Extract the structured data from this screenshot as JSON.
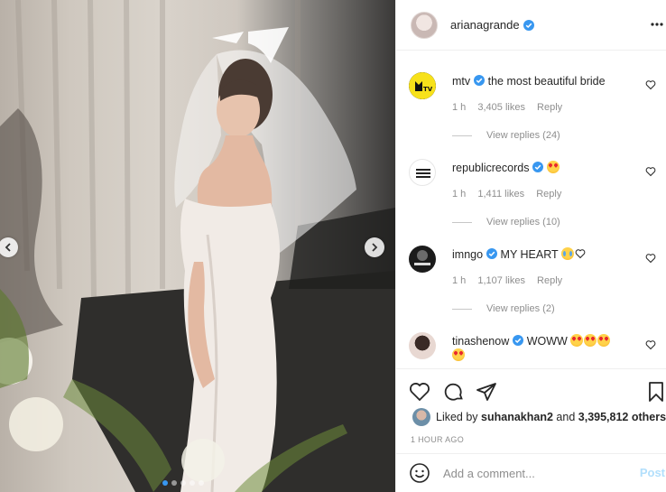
{
  "post": {
    "author": "arianagrande",
    "author_verified": true,
    "photo_description_icon": "photo-icon",
    "carousel_dots": 5,
    "carousel_active_index": 0
  },
  "comments": [
    {
      "username": "mtv",
      "verified": true,
      "text": "the most beautiful bride",
      "time": "1 h",
      "likes": "3,405 likes",
      "reply_label": "Reply",
      "view_replies": "View replies (24)",
      "emoji": []
    },
    {
      "username": "republicrecords",
      "verified": true,
      "text": "",
      "time": "1 h",
      "likes": "1,411 likes",
      "reply_label": "Reply",
      "view_replies": "View replies (10)",
      "emoji": [
        "heart-eyes"
      ]
    },
    {
      "username": "imngo",
      "verified": true,
      "text": "MY HEART",
      "time": "1 h",
      "likes": "1,107 likes",
      "reply_label": "Reply",
      "view_replies": "View replies (2)",
      "emoji": [
        "crying",
        "white-heart"
      ]
    },
    {
      "username": "tinashenow",
      "verified": true,
      "text": "WOWW",
      "emoji": [
        "heart-eyes",
        "heart-eyes",
        "heart-eyes",
        "heart-eyes"
      ]
    }
  ],
  "liked_by": {
    "prefix": "Liked by",
    "user": "suhanakhan2",
    "joiner": "and",
    "others": "3,395,812 others"
  },
  "timestamp": "1 HOUR AGO",
  "comment_box": {
    "placeholder": "Add a comment...",
    "post_label": "Post"
  },
  "colors": {
    "verified_blue": "#3897f0",
    "post_button_disabled": "#b2dffc",
    "muted_text": "#8e8e8e",
    "border": "#efefef"
  }
}
